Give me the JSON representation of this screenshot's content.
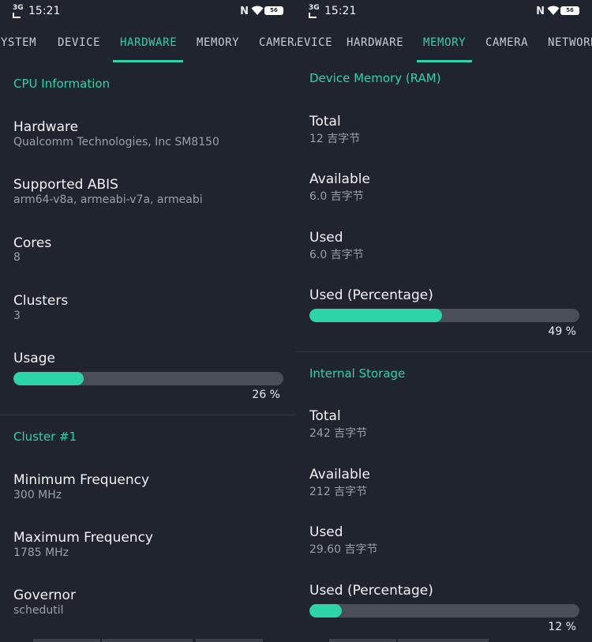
{
  "status_bar": {
    "network": "3G",
    "time": "15:21",
    "nfc": "N",
    "battery": "56"
  },
  "left": {
    "tabs": [
      {
        "label": "SYSTEM"
      },
      {
        "label": "DEVICE"
      },
      {
        "label": "HARDWARE"
      },
      {
        "label": "MEMORY"
      },
      {
        "label": "CAMERA"
      }
    ],
    "active_tab": "HARDWARE",
    "cpu": {
      "title": "CPU Information",
      "items": [
        {
          "label": "Hardware",
          "value": "Qualcomm Technologies, Inc SM8150"
        },
        {
          "label": "Supported ABIS",
          "value": "arm64-v8a, armeabi-v7a, armeabi"
        },
        {
          "label": "Cores",
          "value": "8"
        },
        {
          "label": "Clusters",
          "value": "3"
        }
      ],
      "usage": {
        "label": "Usage",
        "percent": 26,
        "percent_text": "26 %"
      }
    },
    "cluster": {
      "title": "Cluster #1",
      "items": [
        {
          "label": "Minimum Frequency",
          "value": "300 MHz"
        },
        {
          "label": "Maximum Frequency",
          "value": "1785 MHz"
        },
        {
          "label": "Governor",
          "value": "schedutil"
        }
      ]
    }
  },
  "right": {
    "tabs": [
      {
        "label": "DEVICE"
      },
      {
        "label": "HARDWARE"
      },
      {
        "label": "MEMORY"
      },
      {
        "label": "CAMERA"
      },
      {
        "label": "NETWORK"
      }
    ],
    "active_tab": "MEMORY",
    "ram": {
      "title": "Device Memory (RAM)",
      "items": [
        {
          "label": "Total",
          "value": "12 吉字节"
        },
        {
          "label": "Available",
          "value": "6.0 吉字节"
        },
        {
          "label": "Used",
          "value": "6.0 吉字节"
        }
      ],
      "used_pct": {
        "label": "Used (Percentage)",
        "percent": 49,
        "percent_text": "49 %"
      }
    },
    "storage": {
      "title": "Internal Storage",
      "items": [
        {
          "label": "Total",
          "value": "242 吉字节"
        },
        {
          "label": "Available",
          "value": "212 吉字节"
        },
        {
          "label": "Used",
          "value": "29.60 吉字节"
        }
      ],
      "used_pct": {
        "label": "Used (Percentage)",
        "percent": 12,
        "percent_text": "12 %"
      }
    }
  },
  "colors": {
    "accent": "#2ed3a6",
    "background": "#1f242e",
    "track": "#4a4f57",
    "muted_text": "#9aa1ab"
  },
  "icons": {
    "wifi": "wifi-icon",
    "nfc": "nfc-icon",
    "battery": "battery-icon",
    "signal": "signal-icon"
  }
}
